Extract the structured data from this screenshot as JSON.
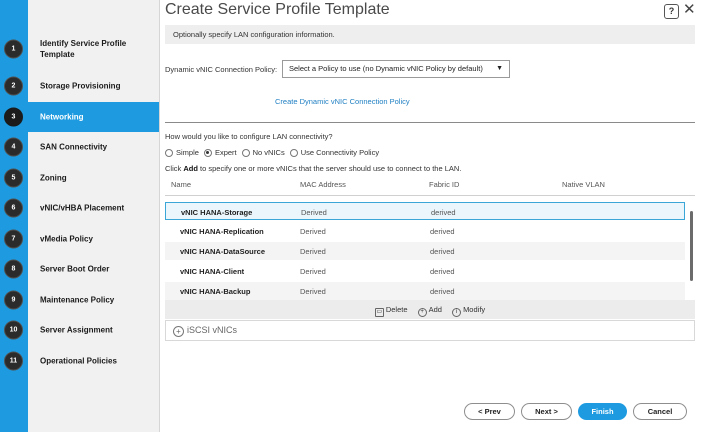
{
  "title": "Create Service Profile Template",
  "wizard_steps": [
    {
      "num": "1",
      "label": "Identify Service Profile Template"
    },
    {
      "num": "2",
      "label": "Storage Provisioning"
    },
    {
      "num": "3",
      "label": "Networking"
    },
    {
      "num": "4",
      "label": "SAN Connectivity"
    },
    {
      "num": "5",
      "label": "Zoning"
    },
    {
      "num": "6",
      "label": "vNIC/vHBA Placement"
    },
    {
      "num": "7",
      "label": "vMedia Policy"
    },
    {
      "num": "8",
      "label": "Server Boot Order"
    },
    {
      "num": "9",
      "label": "Maintenance Policy"
    },
    {
      "num": "10",
      "label": "Server Assignment"
    },
    {
      "num": "11",
      "label": "Operational Policies"
    }
  ],
  "active_step": "3",
  "info": "Optionally specify LAN configuration information.",
  "policy": {
    "label": "Dynamic vNIC Connection Policy:",
    "selected": "Select a Policy to use (no Dynamic vNIC Policy by default)",
    "create_link": "Create Dynamic vNIC Connection Policy"
  },
  "lan": {
    "question": "How would you like to configure LAN connectivity?",
    "options": [
      "Simple",
      "Expert",
      "No vNICs",
      "Use Connectivity Policy"
    ],
    "selected": "Expert",
    "hint_pre": "Click ",
    "hint_bold": "Add",
    "hint_post": " to specify one or more vNICs that the server should use to connect to the LAN."
  },
  "table": {
    "columns": [
      "Name",
      "MAC Address",
      "Fabric ID",
      "Native VLAN"
    ],
    "rows": [
      {
        "name": "vNIC HANA-Storage",
        "mac": "Derived",
        "fabric": "derived",
        "vlan": ""
      },
      {
        "name": "vNIC HANA-Replication",
        "mac": "Derived",
        "fabric": "derived",
        "vlan": ""
      },
      {
        "name": "vNIC HANA-DataSource",
        "mac": "Derived",
        "fabric": "derived",
        "vlan": ""
      },
      {
        "name": "vNIC HANA-Client",
        "mac": "Derived",
        "fabric": "derived",
        "vlan": ""
      },
      {
        "name": "vNIC HANA-Backup",
        "mac": "Derived",
        "fabric": "derived",
        "vlan": ""
      }
    ],
    "selected_row": 0
  },
  "actions": {
    "delete": "Delete",
    "add": "Add",
    "modify": "Modify"
  },
  "iscsi_label": "iSCSI vNICs",
  "buttons": {
    "prev": "< Prev",
    "next": "Next >",
    "finish": "Finish",
    "cancel": "Cancel"
  },
  "colors": {
    "accent": "#1e9be0",
    "link": "#1f7fc3"
  }
}
